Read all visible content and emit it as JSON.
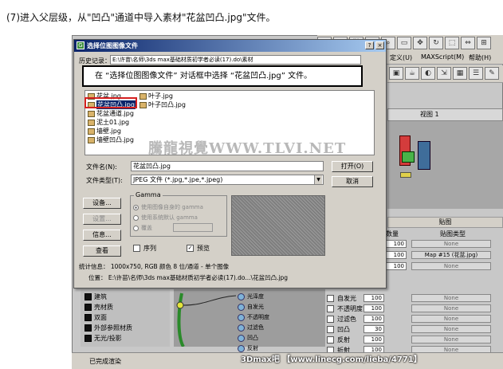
{
  "caption": "(7)进入父层级，从\"凹凸\"通道中导入素材\"花盆凹凸.jpg\"文件。",
  "dialog": {
    "title": "选择位图图像文件",
    "help_btn": "?",
    "close_btn": "×",
    "history_label": "历史记录：",
    "history_value": "E:\\许苗\\名师\\3ds max基础材质初学者必读(17).do\\素材",
    "callout": "在 “选择位图图像文件” 对话框中选择 “花盆凹凸.jpg” 文件。",
    "files_col1": [
      "花盆.jpg",
      "花盆凹凸.jpg",
      "花盆通道.jpg",
      "泥土01.jpg",
      "墙壁.jpg",
      "墙壁凹凸.jpg"
    ],
    "files_col2": [
      "叶子.jpg",
      "叶子凹凸.jpg"
    ],
    "selected_file": "花盆凹凸.jpg",
    "watermark": "騰龍視覺WWW.TLVI.NET",
    "filename_label": "文件名(N):",
    "filename_value": "花盆凹凸.jpg",
    "filetype_label": "文件类型(T):",
    "filetype_value": "JPEG 文件 (*.jpg,*.jpe,*.jpeg)",
    "open_btn": "打开(O)",
    "cancel_btn": "取消",
    "setup_btn": "设备...",
    "settings_btn": "设置...",
    "info_btn": "信息...",
    "view_btn": "查看",
    "gamma_group": "Gamma",
    "gamma_opt1": "使用图像自身的 gamma",
    "gamma_opt2": "使用系统默认 gamma",
    "gamma_opt3": "覆盖",
    "sequence_label": "序列",
    "preview_label": "预览",
    "preview_checked": "✓",
    "stats": "统计信息： 1000x750, RGB 颜色 8 位/通道 - 单个图像",
    "location": "位置： E:\\许苗\\名师\\3ds max基础材质初学者必读(17).do...\\花盆凹凸.jpg"
  },
  "app": {
    "menu": [
      "定义(U)",
      "MAXScript(M)",
      "帮助(H)"
    ],
    "viewport_label": "视图 1",
    "maps_header": "贴图",
    "amount_header": "数量",
    "maptype_header": "贴图类型",
    "map_rows": [
      {
        "name": "",
        "amount": "100",
        "map": "None"
      },
      {
        "name": "",
        "amount": "100",
        "map": "Map #15 (花盆.jpg)"
      },
      {
        "name": "",
        "amount": "100",
        "map": "None"
      },
      {
        "name": "自发光",
        "amount": "100",
        "map": "None"
      },
      {
        "name": "不透明度",
        "amount": "100",
        "map": "None"
      },
      {
        "name": "过滤色",
        "amount": "100",
        "map": "None"
      },
      {
        "name": "凹凸",
        "amount": "30",
        "map": "None"
      },
      {
        "name": "反射",
        "amount": "100",
        "map": "None"
      },
      {
        "name": "折射",
        "amount": "100",
        "map": "None"
      }
    ],
    "materials": [
      "建筑",
      "壳材质",
      "双面",
      "外部参照材质",
      "无光/投影"
    ],
    "nodes": [
      "光泽度",
      "自发光",
      "不透明度",
      "过滤色",
      "凹凸",
      "反射"
    ],
    "status": "已完成渲染",
    "bottom_watermark": "3Dmax吧  【www.linecg.com/lieba/4771】"
  }
}
